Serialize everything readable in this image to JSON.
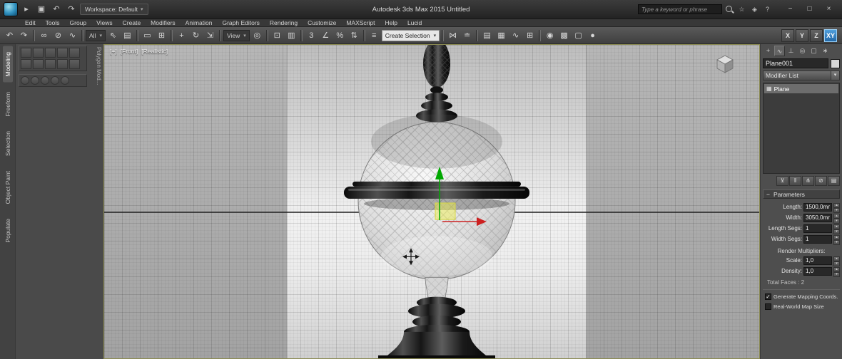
{
  "ui": {
    "dropdown_arrow": "▾",
    "spinner_up": "▴",
    "spinner_down": "▾",
    "rollout_collapse": "−"
  },
  "titlebar": {
    "app_title": "Autodesk 3ds Max 2015    Untitled",
    "workspace_label": "Workspace: Default",
    "search_placeholder": "Type a keyword or phrase",
    "qat_icons": [
      {
        "name": "app-menu-icon",
        "glyph": "▸"
      },
      {
        "name": "save-icon",
        "glyph": "▣"
      },
      {
        "name": "undo-icon",
        "glyph": "↶"
      },
      {
        "name": "redo-icon",
        "glyph": "↷"
      }
    ],
    "info_icons": [
      {
        "name": "favorites-icon",
        "glyph": "☆"
      },
      {
        "name": "community-icon",
        "glyph": "◈"
      },
      {
        "name": "help-icon",
        "glyph": "?"
      }
    ],
    "window_minimize": "−",
    "window_maximize": "□",
    "window_close": "×"
  },
  "menubar": {
    "items": [
      "Edit",
      "Tools",
      "Group",
      "Views",
      "Create",
      "Modifiers",
      "Animation",
      "Graph Editors",
      "Rendering",
      "Customize",
      "MAXScript",
      "Help",
      "Lucid"
    ]
  },
  "toolbar": {
    "filter_combo": "All",
    "coord_combo": "View",
    "named_sets_combo": "Create Selection",
    "icons": [
      {
        "name": "undo-icon",
        "glyph": "↶"
      },
      {
        "name": "redo-icon",
        "glyph": "↷"
      },
      {
        "name": "select-and-link-icon",
        "glyph": "∞"
      },
      {
        "name": "unlink-selection-icon",
        "glyph": "⊘"
      },
      {
        "name": "bind-to-space-warp-icon",
        "glyph": "∿"
      },
      {
        "name": "select-object-icon",
        "glyph": "⇖"
      },
      {
        "name": "select-by-name-icon",
        "glyph": "▤"
      },
      {
        "name": "selection-region-icon",
        "glyph": "▭"
      },
      {
        "name": "window-crossing-icon",
        "glyph": "⊞"
      },
      {
        "name": "select-and-move-icon",
        "glyph": "+"
      },
      {
        "name": "select-and-rotate-icon",
        "glyph": "↻"
      },
      {
        "name": "select-and-scale-icon",
        "glyph": "⇲"
      },
      {
        "name": "use-pivot-center-icon",
        "glyph": "◎"
      },
      {
        "name": "select-and-manipulate-icon",
        "glyph": "⊡"
      },
      {
        "name": "keyboard-override-icon",
        "glyph": "▥"
      },
      {
        "name": "snap-toggle-icon",
        "glyph": "3"
      },
      {
        "name": "angle-snap-icon",
        "glyph": "∠"
      },
      {
        "name": "percent-snap-icon",
        "glyph": "%"
      },
      {
        "name": "spinner-snap-icon",
        "glyph": "⇅"
      },
      {
        "name": "named-sets-icon",
        "glyph": "≡"
      },
      {
        "name": "mirror-icon",
        "glyph": "⋈"
      },
      {
        "name": "align-icon",
        "glyph": "≐"
      },
      {
        "name": "layer-manager-icon",
        "glyph": "▤"
      },
      {
        "name": "ribbon-toggle-icon",
        "glyph": "▦"
      },
      {
        "name": "curve-editor-icon",
        "glyph": "∿"
      },
      {
        "name": "schematic-view-icon",
        "glyph": "⊞"
      },
      {
        "name": "material-editor-icon",
        "glyph": "◉"
      },
      {
        "name": "render-setup-icon",
        "glyph": "▩"
      },
      {
        "name": "rendered-frame-icon",
        "glyph": "▢"
      },
      {
        "name": "render-production-icon",
        "glyph": "●"
      }
    ],
    "axis_x": "X",
    "axis_y": "Y",
    "axis_z": "Z",
    "axis_xy": "XY"
  },
  "ribbon": {
    "tabs": [
      "Modeling",
      "Freeform",
      "Selection",
      "Object Paint",
      "Populate"
    ],
    "panel_label": "Polygon Mod..."
  },
  "viewport": {
    "nav_label": "[+]",
    "view_label": "[Front]",
    "shading_label": "[Realistic]"
  },
  "command_panel": {
    "tabs": [
      {
        "name": "tab-create",
        "glyph": "+"
      },
      {
        "name": "tab-modify",
        "glyph": "∿"
      },
      {
        "name": "tab-hierarchy",
        "glyph": "⊥"
      },
      {
        "name": "tab-motion",
        "glyph": "◎"
      },
      {
        "name": "tab-display",
        "glyph": "▢"
      },
      {
        "name": "tab-utilities",
        "glyph": "∗"
      }
    ],
    "object_name": "Plane001",
    "modifier_list_label": "Modifier List",
    "stack_item_icon": "▦",
    "stack_item_label": "Plane",
    "stack_buttons": [
      {
        "name": "pin-stack-icon",
        "glyph": "⊻"
      },
      {
        "name": "show-end-result-icon",
        "glyph": "‖"
      },
      {
        "name": "make-unique-icon",
        "glyph": "⋔"
      },
      {
        "name": "remove-modifier-icon",
        "glyph": "⊘"
      },
      {
        "name": "configure-modifier-sets-icon",
        "glyph": "▤"
      }
    ],
    "rollout_title": "Parameters",
    "params": [
      {
        "label": "Length:",
        "value": "1500,0mm"
      },
      {
        "label": "Width:",
        "value": "3050,0mm"
      },
      {
        "label": "Length Segs:",
        "value": "1"
      },
      {
        "label": "Width Segs:",
        "value": "1"
      }
    ],
    "render_multipliers_label": "Render Multipliers:",
    "multipliers": [
      {
        "label": "Scale:",
        "value": "1,0"
      },
      {
        "label": "Density:",
        "value": "1,0"
      }
    ],
    "total_faces_label": "Total Faces : 2",
    "checkboxes": [
      {
        "label": "Generate Mapping Coords.",
        "mark": "✓"
      },
      {
        "label": "Real-World Map Size",
        "mark": ""
      }
    ]
  }
}
